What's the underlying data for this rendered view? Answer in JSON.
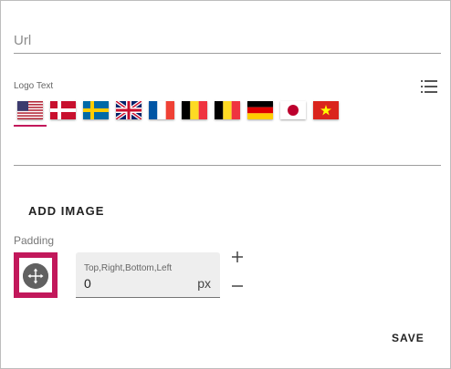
{
  "url_field": {
    "placeholder": "Url"
  },
  "logo_text": {
    "label": "Logo Text",
    "flags": [
      {
        "name": "us-flag-icon",
        "active": true
      },
      {
        "name": "denmark-flag-icon"
      },
      {
        "name": "sweden-flag-icon"
      },
      {
        "name": "uk-flag-icon"
      },
      {
        "name": "france-flag-icon"
      },
      {
        "name": "belgium-flag-icon"
      },
      {
        "name": "belgium-flag-icon"
      },
      {
        "name": "germany-flag-icon"
      },
      {
        "name": "japan-flag-icon"
      },
      {
        "name": "vietnam-flag-icon"
      }
    ],
    "value": ""
  },
  "add_image": {
    "label": "ADD IMAGE"
  },
  "padding": {
    "label": "Padding",
    "field_label": "Top,Right,Bottom,Left",
    "value": "0",
    "unit": "px"
  },
  "save": {
    "label": "SAVE"
  },
  "colors": {
    "accent": "#c2185b",
    "knob": "#616161",
    "field_bg": "#eeeeee"
  }
}
